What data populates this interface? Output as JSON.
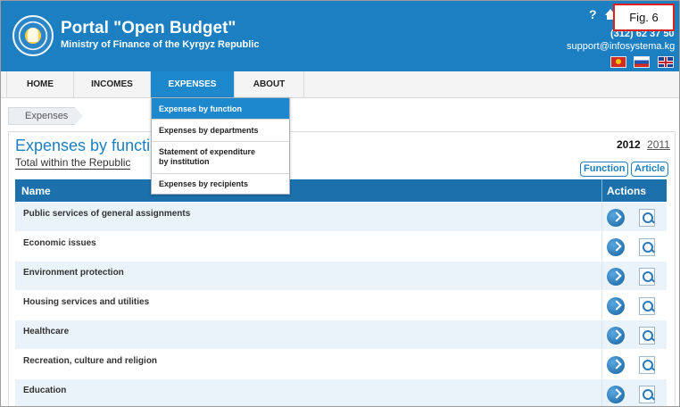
{
  "header": {
    "title": "Portal \"Open Budget\"",
    "subtitle": "Ministry of Finance of the Kyrgyz Republic",
    "help_icon": "?",
    "phone": "(312) 62 37 50",
    "support_email": "support@infosystema.kg",
    "languages": [
      "kg-flag-icon",
      "ru-flag-icon",
      "en-flag-icon"
    ]
  },
  "figure_label": "Fig. 6",
  "nav": {
    "home": "HOME",
    "incomes": "INCOMES",
    "expenses": "EXPENSES",
    "about": "ABOUT"
  },
  "dropdown": {
    "items": [
      "Expenses by function",
      "Expenses by departments",
      "Statement of expenditure by institution",
      "Expenses by recipients"
    ],
    "item_3_line1": "Statement of expenditure",
    "item_3_line2": "by institution",
    "selected": "Expenses by function"
  },
  "breadcrumb": "Expenses",
  "main": {
    "title": "Expenses by function",
    "subtitle": "Total within the Republic",
    "year_current": "2012",
    "year_other": "2011",
    "function_button": "Function",
    "article_button": "Article"
  },
  "table": {
    "headers": {
      "name": "Name",
      "actions": "Actions"
    },
    "rows": [
      "Public services of general assignments",
      "Economic issues",
      "Environment protection",
      "Housing services and utilities",
      "Healthcare",
      "Recreation, culture and religion",
      "Education"
    ]
  },
  "colors": {
    "header_blue": "#1b7fc2",
    "table_header": "#1c71ad",
    "active_nav": "#1e88cc",
    "row_alt": "#eaf3fa",
    "fig_border": "#e0201d"
  }
}
